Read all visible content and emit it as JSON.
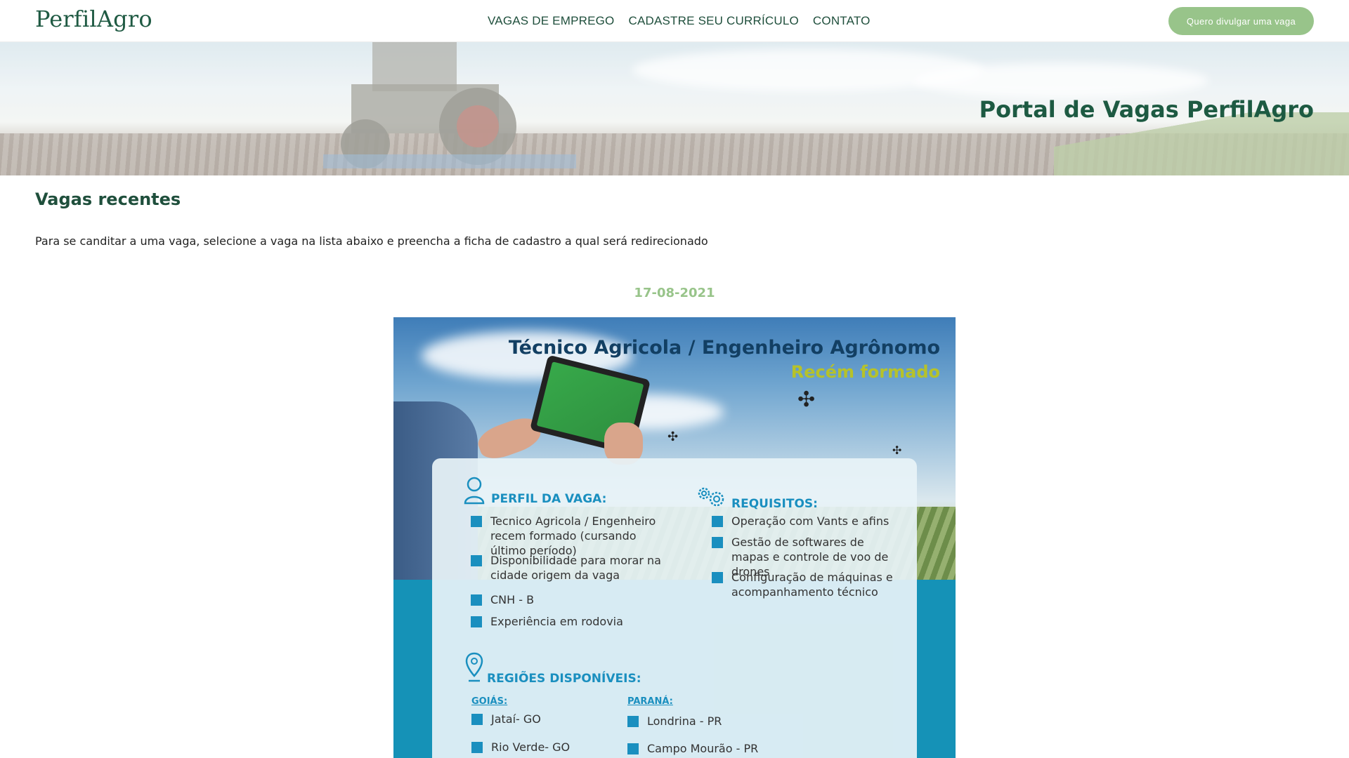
{
  "nav": {
    "logo": "PerfilAgro",
    "links": [
      "VAGAS DE EMPREGO",
      "CADASTRE SEU CURRÍCULO",
      "CONTATO"
    ],
    "cta_label": "Quero divulgar uma vaga"
  },
  "hero": {
    "title": "Portal de Vagas PerfilAgro"
  },
  "main": {
    "section_title": "Vagas recentes",
    "intro": "Para se canditar a uma vaga, selecione a vaga na lista abaixo e preencha a ficha de cadastro a qual será redirecionado",
    "date": "17-08-2021"
  },
  "job_flyer": {
    "title": "Técnico Agricola / Engenheiro Agrônomo",
    "subtitle": "Recém formado",
    "profile_heading": "PERFIL DA VAGA:",
    "profile_items": [
      "Tecnico Agricola / Engenheiro recem formado (cursando último período)",
      "Disponibilidade para morar na cidade origem da vaga",
      "CNH - B",
      "Experiência em rodovia"
    ],
    "requirements_heading": "REQUISITOS:",
    "requirements_items": [
      "Operação com Vants e afins",
      "Gestão de softwares de mapas e controle de voo de drones",
      "Configuração de máquinas e acompanhamento técnico"
    ],
    "regions_heading": "REGIÕES DISPONÍVEIS:",
    "region_goias": "GOIÁS:",
    "goias_items": [
      "Jataí- GO",
      "Rio Verde- GO"
    ],
    "region_parana": "PARANÁ:",
    "parana_items": [
      "Londrina - PR",
      "Campo Mourão - PR"
    ]
  },
  "colors": {
    "brand_green": "#1f5a43",
    "accent_green": "#98c48a",
    "flyer_blue": "#1a8fbf"
  }
}
